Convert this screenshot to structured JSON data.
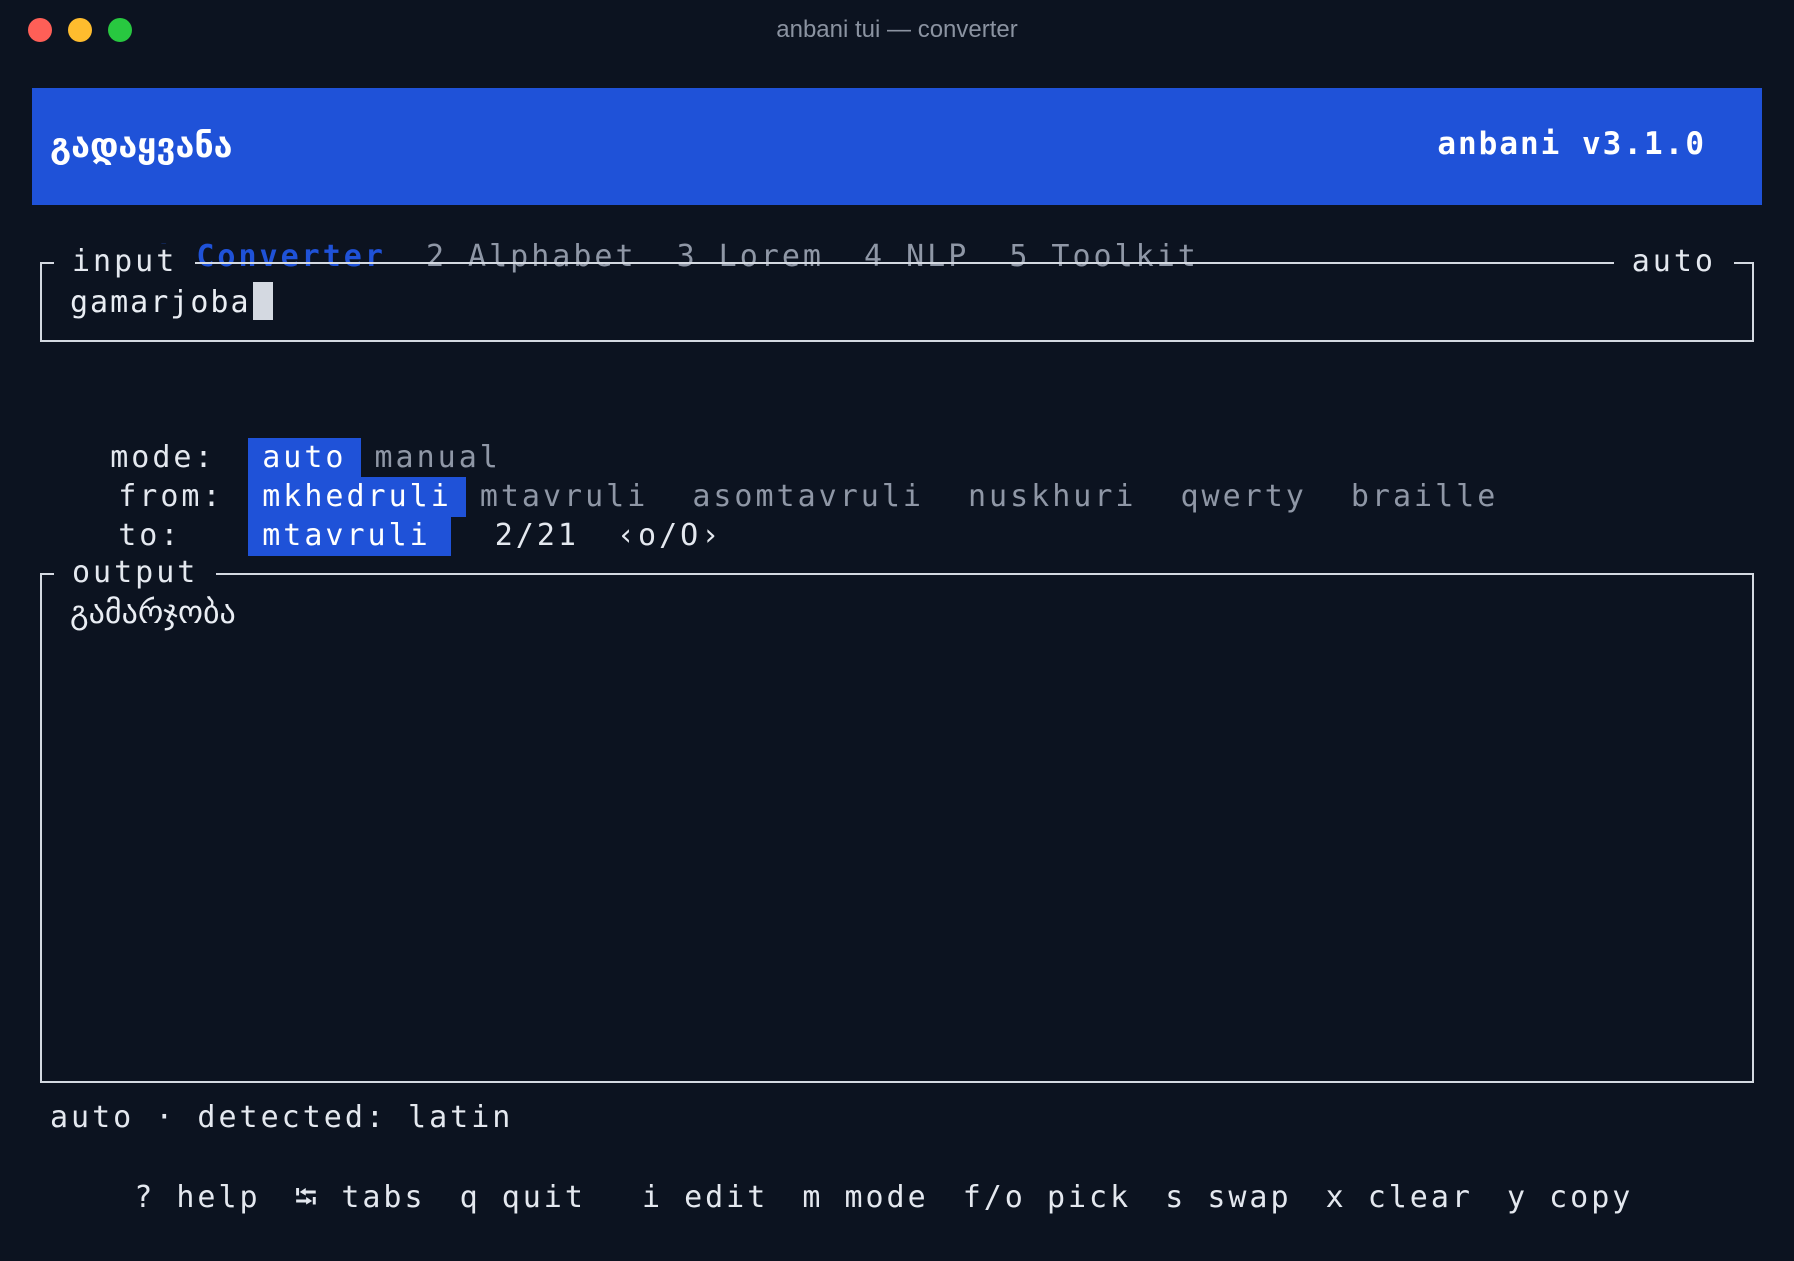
{
  "window": {
    "title": "anbani tui — converter"
  },
  "header": {
    "app_name": "გადაყვანა",
    "version": "anbani v3.1.0"
  },
  "tabs": [
    {
      "label": "1 Converter",
      "active": true
    },
    {
      "label": "2 Alphabet",
      "active": false
    },
    {
      "label": "3 Lorem",
      "active": false
    },
    {
      "label": "4 NLP",
      "active": false
    },
    {
      "label": "5 Toolkit",
      "active": false
    }
  ],
  "input": {
    "label": "input",
    "mode_label": "auto",
    "value": "gamarjoba"
  },
  "options": {
    "mode": {
      "label": "mode:",
      "items": [
        "auto",
        "manual"
      ],
      "selected": "auto"
    },
    "from": {
      "label": "from:",
      "items": [
        "mkhedruli",
        "mtavruli",
        "asomtavruli",
        "nuskhuri",
        "qwerty",
        "braille"
      ],
      "selected": "mkhedruli"
    },
    "to": {
      "label": "to:",
      "selected": "mtavruli",
      "position": "2/21",
      "hint": "‹o/O›"
    }
  },
  "output": {
    "label": "output",
    "value": "გამარჯობა"
  },
  "status": {
    "text": "auto · detected: latin"
  },
  "keys": [
    {
      "key": "?",
      "action": "help"
    },
    {
      "key": "⭾",
      "action": "tabs"
    },
    {
      "key": "q",
      "action": "quit"
    },
    {
      "key": "i",
      "action": "edit"
    },
    {
      "key": "m",
      "action": "mode"
    },
    {
      "key": "f/o",
      "action": "pick"
    },
    {
      "key": "s",
      "action": "swap"
    },
    {
      "key": "x",
      "action": "clear"
    },
    {
      "key": "y",
      "action": "copy"
    }
  ],
  "colors": {
    "background": "#0c1320",
    "accent": "#1f52d8",
    "muted": "#8f97a6",
    "text": "#e4e8ef"
  }
}
